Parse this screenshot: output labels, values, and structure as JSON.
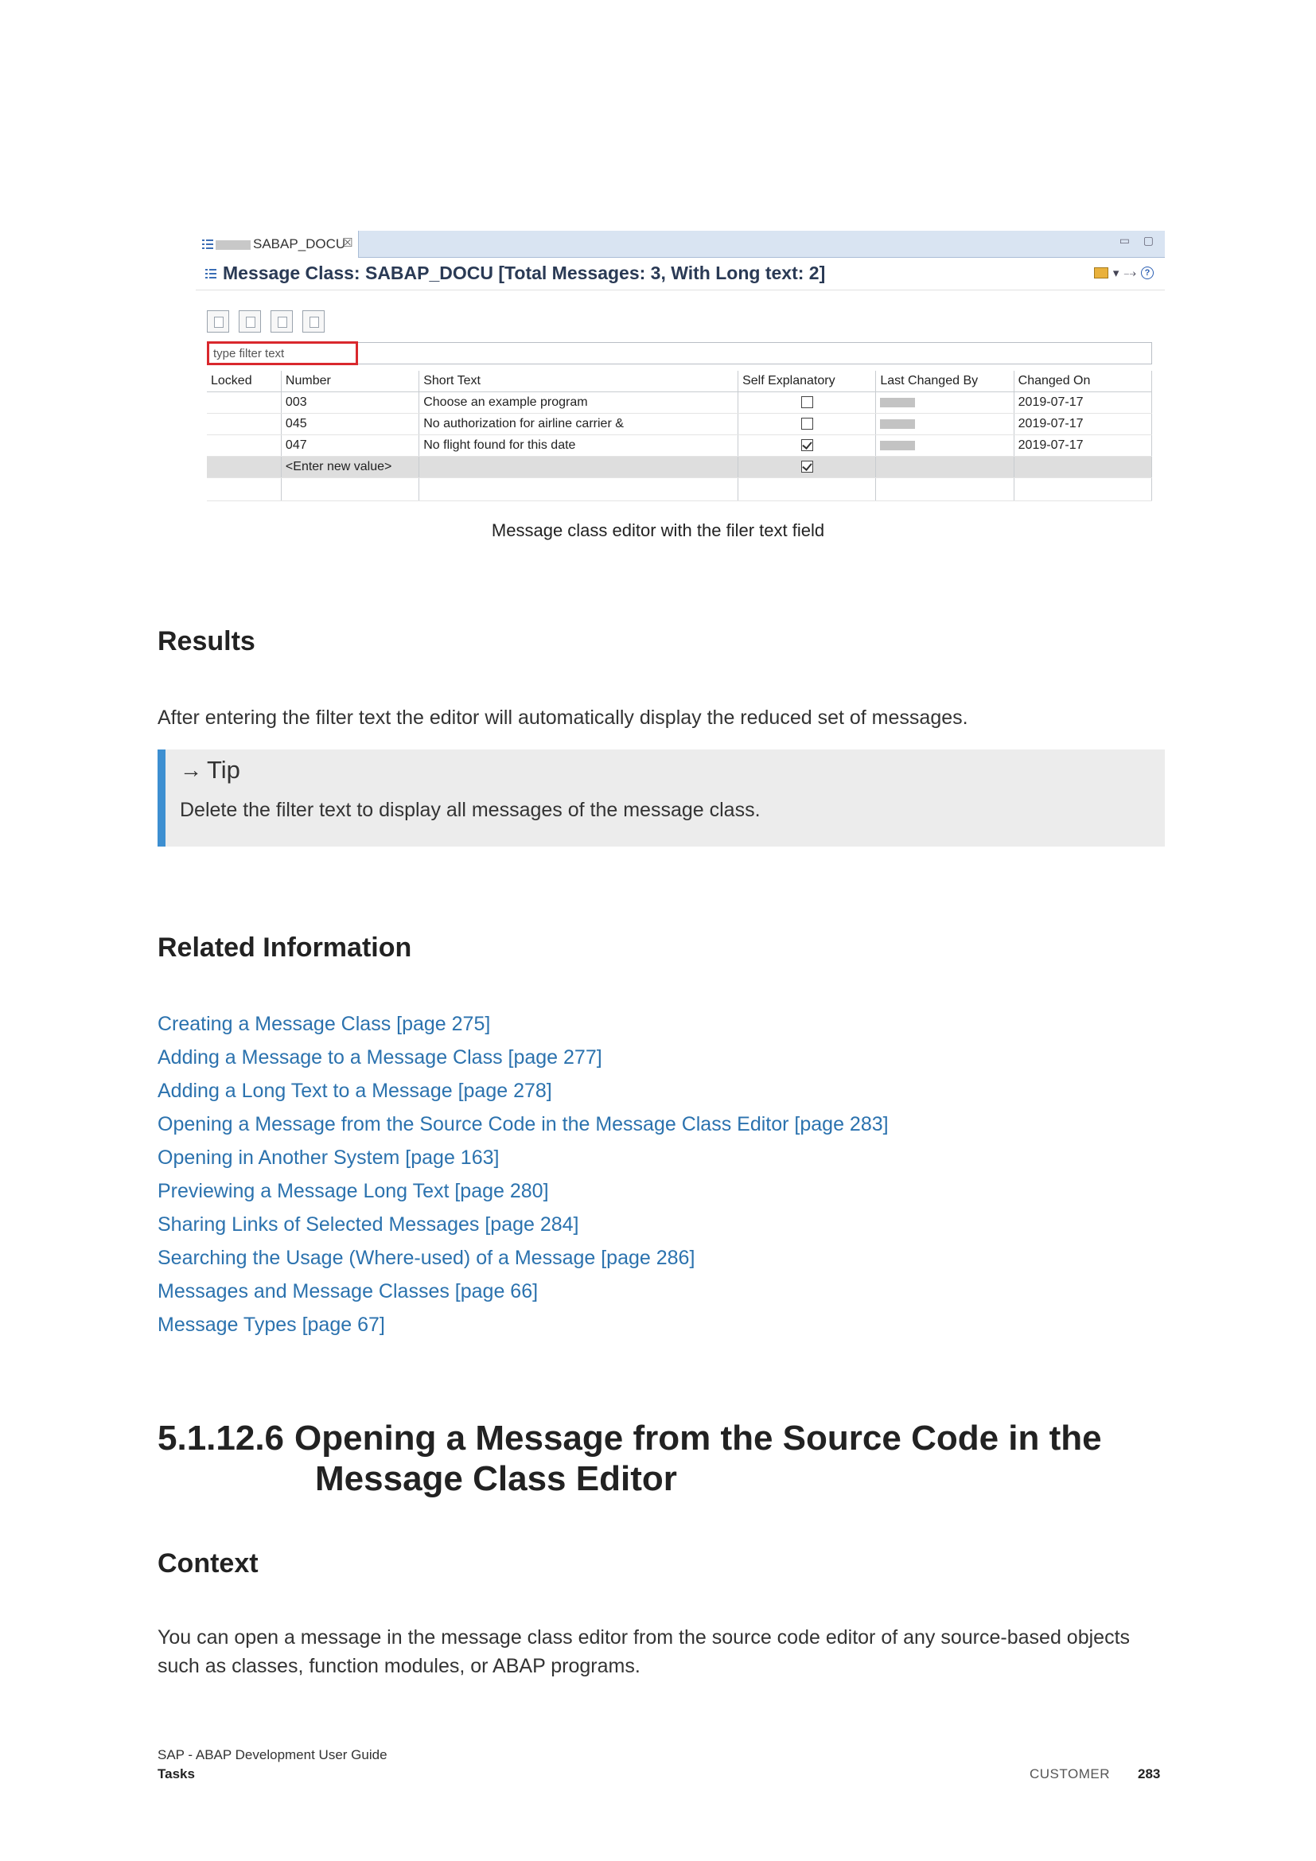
{
  "figure": {
    "tab_title": "SABAP_DOCU",
    "tab_close": "☒",
    "window_min": "▭",
    "window_max": "▢",
    "editor_title": "Message Class: SABAP_DOCU [Total Messages: 3, With Long text: 2]",
    "filter_placeholder": "type filter text",
    "columns": [
      "Locked",
      "Number",
      "Short Text",
      "Self Explanatory",
      "Last Changed By",
      "Changed On"
    ],
    "rows": [
      {
        "locked": "",
        "number": "003",
        "short_text": "Choose an example program",
        "self_explanatory": false,
        "changed_on": "2019-07-17"
      },
      {
        "locked": "",
        "number": "045",
        "short_text": "No authorization for airline carrier &",
        "self_explanatory": false,
        "changed_on": "2019-07-17"
      },
      {
        "locked": "",
        "number": "047",
        "short_text": "No flight found for this date",
        "self_explanatory": true,
        "changed_on": "2019-07-17"
      }
    ],
    "new_row_label": "<Enter new value>",
    "new_row_self_explanatory": true,
    "caption": "Message class editor with the filer text field"
  },
  "results": {
    "heading": "Results",
    "text": "After entering the filter text the editor will automatically display the reduced set of messages."
  },
  "tip": {
    "label": "Tip",
    "text": "Delete the filter text to display all messages of the message class."
  },
  "related": {
    "heading": "Related Information",
    "links": [
      "Creating a Message Class [page 275]",
      "Adding a Message to a Message Class [page 277]",
      "Adding a Long Text to a Message [page 278]",
      "Opening a Message from the Source Code in the Message Class Editor [page 283]",
      "Opening in Another System [page 163]",
      "Previewing a Message Long Text [page 280]",
      "Sharing Links of Selected Messages [page 284]",
      "Searching the Usage (Where-used) of a Message [page 286]",
      "Messages and Message Classes [page 66]",
      "Message Types [page 67]"
    ]
  },
  "chapter": {
    "number": "5.1.12.6",
    "title_line1": "Opening a Message from the Source Code in the",
    "title_line2": "Message Class Editor"
  },
  "context": {
    "heading": "Context",
    "text": "You can open a message in the message class editor from the source code editor of any source-based objects such as classes, function modules, or ABAP programs."
  },
  "footer": {
    "guide": "SAP - ABAP Development User Guide",
    "section": "Tasks",
    "classification": "CUSTOMER",
    "page": "283"
  },
  "colors": {
    "link": "#2b72ae",
    "tip_bar": "#3d8fd1",
    "tip_background": "#ececec",
    "filter_highlight": "#d9282d"
  }
}
